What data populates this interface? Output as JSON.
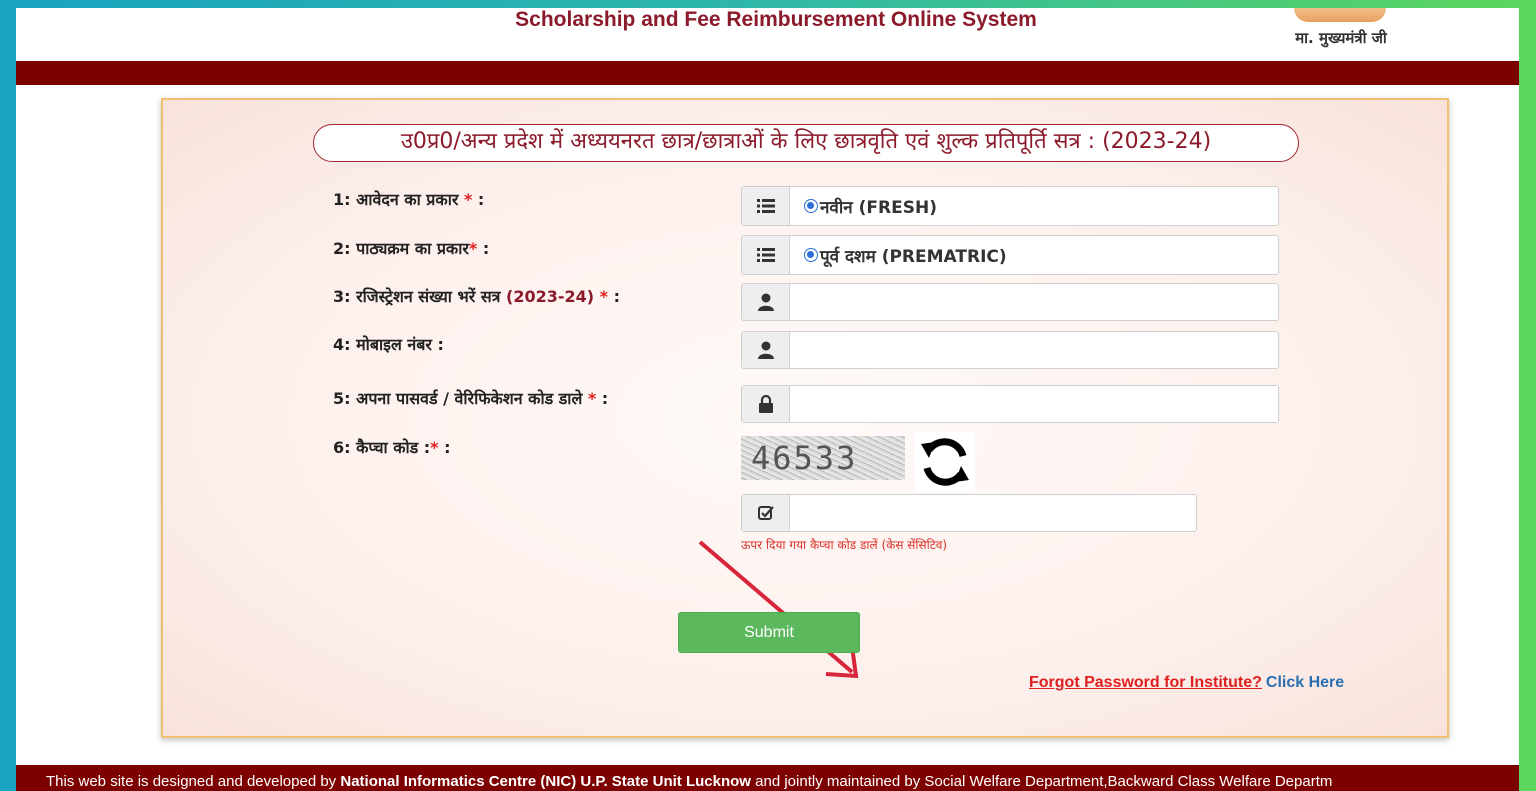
{
  "header": {
    "site_title": "Scholarship and Fee Reimbursement Online System",
    "cm_label": "मा. मुख्यमंत्री जी",
    "band_color": "#7d0000"
  },
  "form": {
    "heading": "उ0प्र0/अन्य प्रदेश में अध्ययनरत छात्र/छात्राओं के लिए छात्रवृति एवं शुल्क प्रतिपूर्ति सत्र : (2023-24)",
    "fields": [
      {
        "label": "1: आवेदन का प्रकार",
        "required": "*",
        "suffix": " :",
        "icon": "list-icon",
        "type": "radio",
        "value": "नवीन (FRESH)"
      },
      {
        "label": "2: पाठ्यक्रम का प्रकार",
        "required": "*",
        "suffix": " :",
        "icon": "list-icon",
        "type": "radio",
        "value": "पूर्व दशम (PREMATRIC)"
      },
      {
        "label": "3: रजिस्ट्रेशन संख्या भरें सत्र ",
        "session": "(2023-24)",
        "required": " *",
        "suffix": " :",
        "icon": "user-icon",
        "type": "text",
        "value": ""
      },
      {
        "label": "4: मोबाइल नंबर :",
        "icon": "user-icon",
        "type": "text",
        "value": ""
      },
      {
        "label": "5: अपना पासवर्ड / वेरिफिकेशन कोड डाले",
        "required": " *",
        "suffix": " :",
        "icon": "lock-icon",
        "type": "password",
        "value": ""
      },
      {
        "label": "6: कैप्चा कोड :",
        "required": "*",
        "suffix": " :",
        "icon": "check-square-icon",
        "type": "text",
        "value": ""
      }
    ],
    "captcha": {
      "code": "46533",
      "hint": "ऊपर दिया गया कैप्चा कोड डालें (केस सेंसिटिव)"
    },
    "submit_label": "Submit",
    "forgot_label": "Forgot Password for Institute?",
    "click_here_label": "Click Here",
    "submit_color": "#5cb85c"
  },
  "footer": {
    "text_part1": "This web site is designed and developed by ",
    "text_bold": "National Informatics Centre (NIC) U.P. State Unit Lucknow",
    "text_part2": " and jointly maintained by Social Welfare Department,Backward Class Welfare Departm"
  }
}
